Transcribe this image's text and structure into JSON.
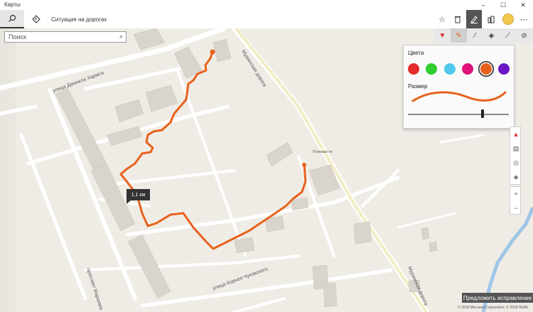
{
  "window": {
    "title": "Карты",
    "controls": {
      "minimize": "–",
      "maximize": "☐",
      "close": "✕"
    }
  },
  "toolbar": {
    "search_tab_icon": "search-icon",
    "directions_icon": "directions-icon",
    "traffic_label": "Ситуация на дорогах",
    "right_icons": [
      "favorites-icon",
      "trash-icon",
      "ink-pen-icon",
      "3d-cities-icon"
    ],
    "avatar_icon": "avatar"
  },
  "search": {
    "placeholder": "Поиск"
  },
  "ink_toolbar": {
    "items": [
      "pen-red-icon",
      "pen-orange-icon",
      "highlighter-icon",
      "direction-pen-icon",
      "measure-icon",
      "select-pen-icon"
    ]
  },
  "ink_flyout": {
    "colors_label": "Цвета",
    "colors": [
      "#e52b2b",
      "#2fcd2f",
      "#4fc8ea",
      "#e0147c",
      "#e8611c",
      "#6b17c6"
    ],
    "selected_color": "#e8611c",
    "size_label": "Размер",
    "size_value": 0.76
  },
  "map": {
    "street_labels": [
      "улица Даниила Хармса",
      "Муринская дорога",
      "улица Корнея Чуковского",
      "проспект Маршака",
      "Муринская дорога",
      "Полевые ти"
    ],
    "distance_label": "1,1 км",
    "route_color": "#e8611c",
    "controls": [
      "compass-icon",
      "tilt-icon",
      "location-icon",
      "map-layers-icon",
      "zoom-in-icon",
      "zoom-out-icon"
    ]
  },
  "footer": {
    "suggest_button": "Предложить исправление",
    "copyright": "© 2018 Microsoft Corporation, © 2018 HERE"
  }
}
